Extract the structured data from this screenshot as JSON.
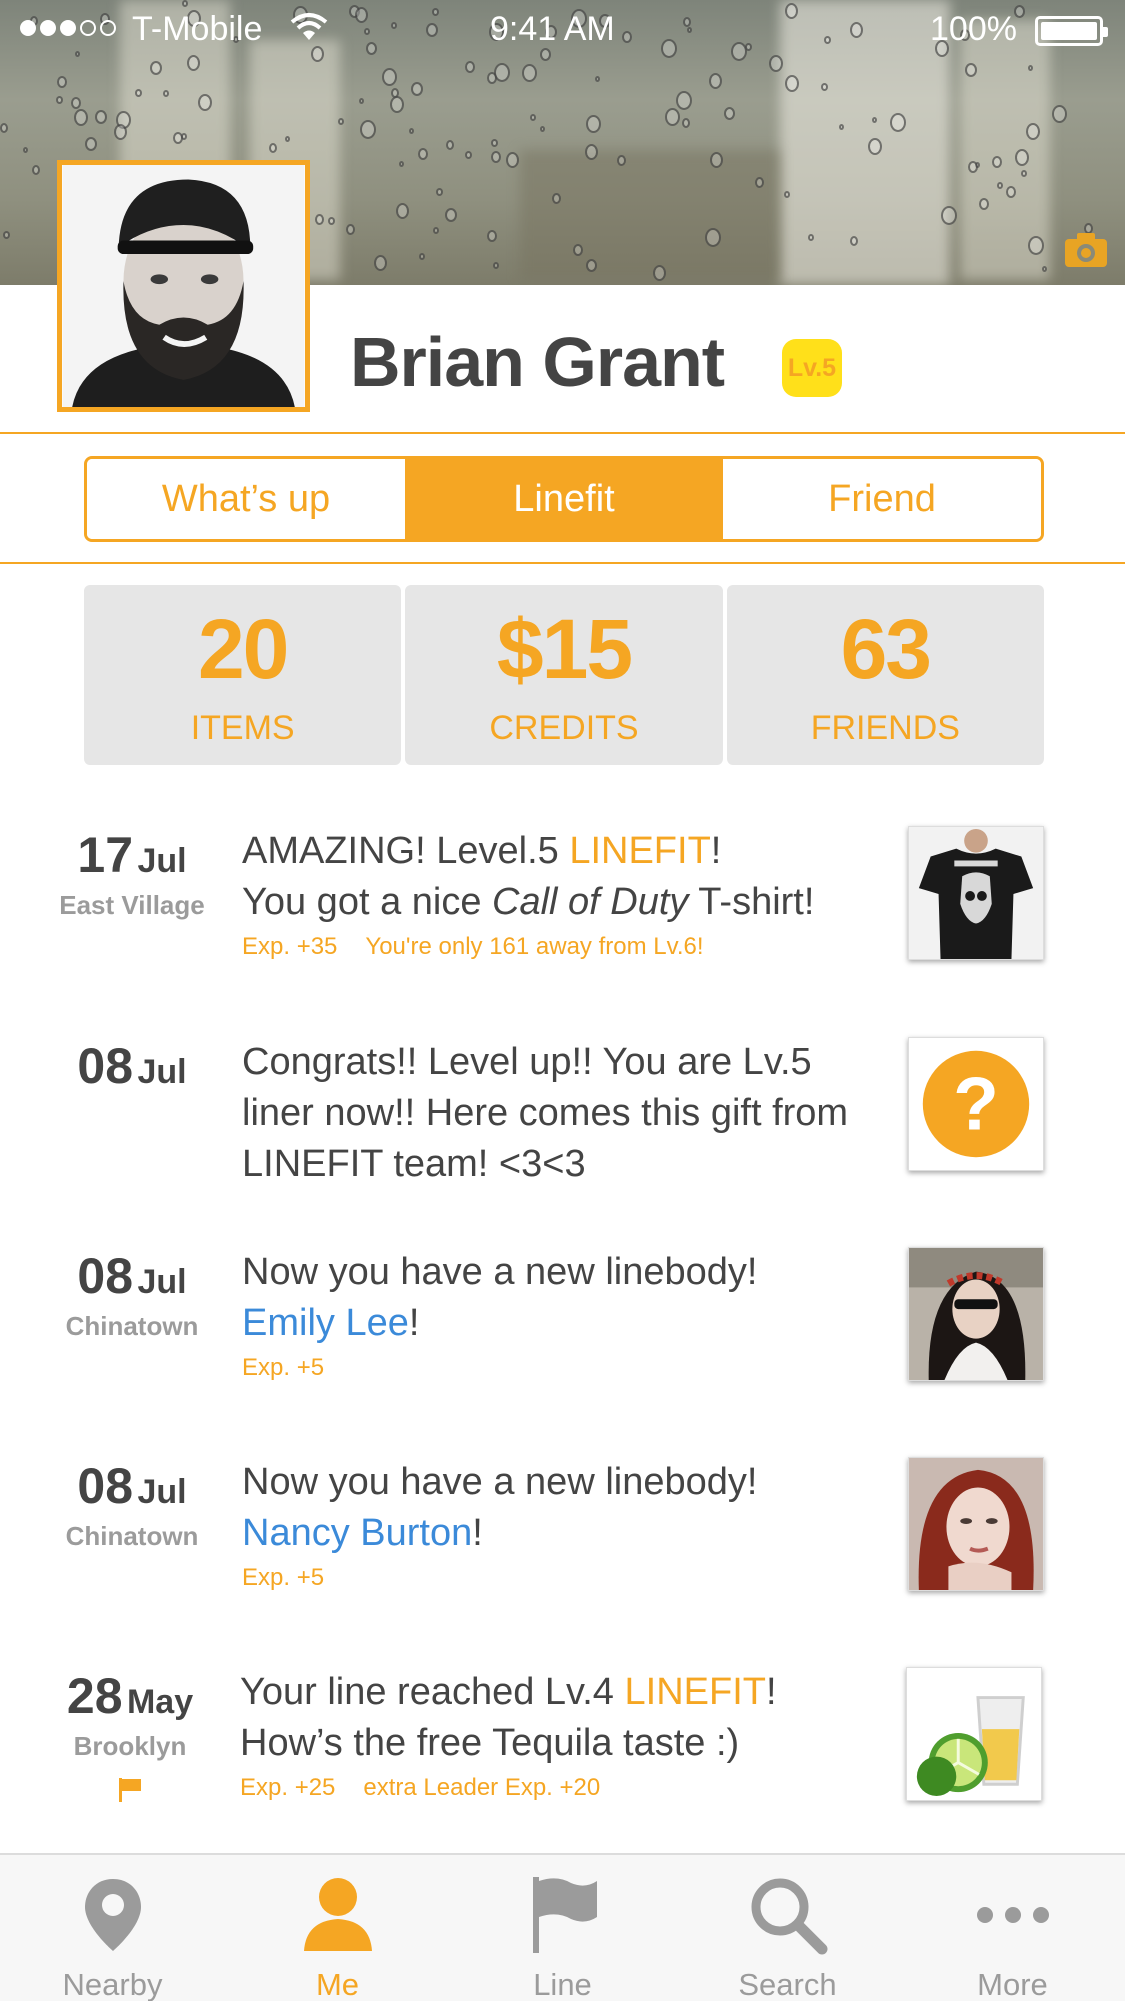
{
  "status_bar": {
    "carrier": "T-Mobile",
    "time": "9:41 AM",
    "battery": "100%"
  },
  "profile": {
    "name": "Brian Grant",
    "level": "Lv.5"
  },
  "tabs": [
    {
      "label": "What’s up",
      "active": false
    },
    {
      "label": "Linefit",
      "active": true
    },
    {
      "label": "Friend",
      "active": false
    }
  ],
  "stats": [
    {
      "value": "20",
      "label": "ITEMS"
    },
    {
      "value": "$15",
      "label": "CREDITS"
    },
    {
      "value": "63",
      "label": "FRIENDS"
    }
  ],
  "feed": [
    {
      "day": "17",
      "month": "Jul",
      "location": "East Village",
      "line1_pre": "AMAZING! Level.5 ",
      "line1_hl": "LINEFIT",
      "line1_post": "!",
      "line2_pre": "You got a nice ",
      "line2_em": "Call of Duty",
      "line2_post": " T-shirt!",
      "exp1": "Exp. +35",
      "exp2": "You're only 161 away from Lv.6!",
      "thumb": "call-of-duty-tshirt"
    },
    {
      "day": "08",
      "month": "Jul",
      "text": "Congrats!! Level up!! You are Lv.5 liner now!! Here comes this gift from LINEFIT team! <3<3",
      "thumb": "mystery-gift"
    },
    {
      "day": "08",
      "month": "Jul",
      "location": "Chinatown",
      "line1": "Now you have a new linebody!",
      "friend": "Emily Lee",
      "suffix": "!",
      "exp1": "Exp. +5",
      "thumb": "emily-lee-photo"
    },
    {
      "day": "08",
      "month": "Jul",
      "location": "Chinatown",
      "line1": "Now you have a new linebody!",
      "friend": "Nancy Burton",
      "suffix": "!",
      "exp1": "Exp. +5",
      "thumb": "nancy-burton-photo"
    },
    {
      "day": "28",
      "month": "May",
      "location": "Brooklyn",
      "line1_pre": "Your line reached Lv.4 ",
      "line1_hl": "LINEFIT",
      "line1_post": "!",
      "line2": "How’s the free Tequila taste :)",
      "exp1": "Exp. +25",
      "exp2": "extra Leader Exp. +20",
      "thumb": "tequila-lime"
    }
  ],
  "tabbar": [
    {
      "label": "Nearby",
      "icon": "pin-icon",
      "active": false
    },
    {
      "label": "Me",
      "icon": "person-icon",
      "active": true
    },
    {
      "label": "Line",
      "icon": "flag-icon",
      "active": false
    },
    {
      "label": "Search",
      "icon": "search-icon",
      "active": false
    },
    {
      "label": "More",
      "icon": "more-icon",
      "active": false
    }
  ],
  "colors": {
    "accent": "#f5a623",
    "link": "#3b8ad9",
    "badge": "#ffe01a",
    "muted": "#9b9b9b"
  }
}
